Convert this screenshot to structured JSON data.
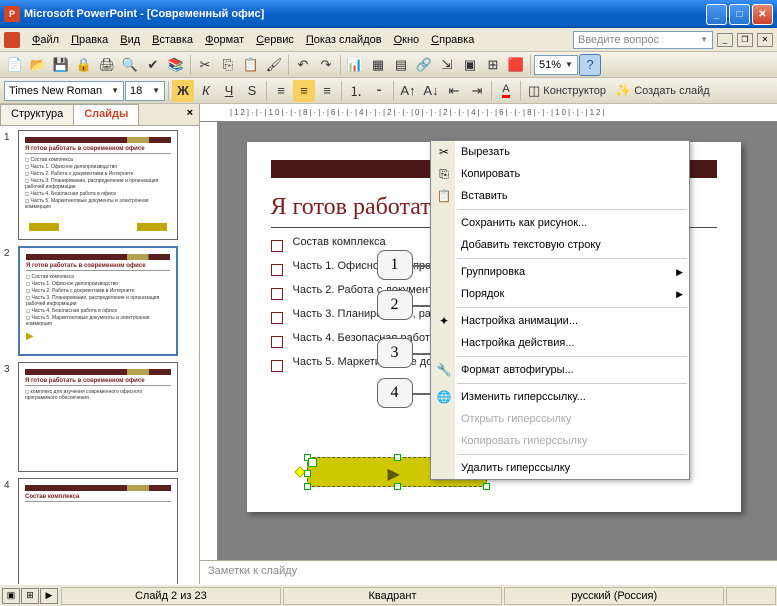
{
  "titlebar": {
    "app": "Microsoft PowerPoint",
    "doc": "[Современный офис]"
  },
  "menus": [
    "Файл",
    "Правка",
    "Вид",
    "Вставка",
    "Формат",
    "Сервис",
    "Показ слайдов",
    "Окно",
    "Справка"
  ],
  "help_placeholder": "Введите вопрос",
  "zoom": "51%",
  "font": {
    "name": "Times New Roman",
    "size": "18"
  },
  "design_btn": "Конструктор",
  "newslide_btn": "Создать слайд",
  "tabs": {
    "structure": "Структура",
    "slides": "Слайды"
  },
  "ruler": "|12|·|·|10|·|·|8|·|·|6|·|·|4|·|·|2|·|·|0|·|·|2|·|·|4|·|·|6|·|·|8|·|·|10|·|·|12|",
  "thumbs": [
    {
      "n": "1",
      "title": "Я готов работать в современном офисе",
      "lines": [
        "Состав комплекса",
        "Часть 1. Офисное делопроизводство",
        "Часть 2. Работа с документами в Интернете",
        "Часть 3. Планирование, распределение и организация рабочей информации",
        "Часть 4. Безопасная работа в офисе",
        "Часть 5. Маркетинговые документы и электронная коммерция"
      ]
    },
    {
      "n": "2",
      "title": "Я готов работать в современном офисе",
      "lines": [
        "Состав комплекса",
        "Часть 1. Офисное делопроизводство",
        "Часть 2. Работа с документами в Интернете",
        "Часть 3. Планирование, распределение и организация рабочей информации",
        "Часть 4. Безопасная работа в офисе",
        "Часть 5. Маркетинговые документы и электронная коммерция"
      ]
    },
    {
      "n": "3",
      "title": "Я готов работать в современном офисе",
      "lines": [
        "комплекс для изучения современного офисного программного обеспечения"
      ]
    },
    {
      "n": "4",
      "title": "Состав комплекса",
      "lines": []
    }
  ],
  "slide": {
    "title": "Я готов работать в современном офисе",
    "items": [
      "Состав комплекса",
      "Часть 1. Офисное делопроизводство",
      "Часть 2. Работа с документами в Интернете",
      "Часть 3. Планирование, распределение и организация рабочей информации",
      "Часть 4. Безопасная работа в офисе",
      "Часть 5. Маркетинговые документы и электронная коммерция"
    ]
  },
  "callouts": [
    "1",
    "2",
    "3",
    "4"
  ],
  "context_menu": [
    {
      "label": "Вырезать",
      "icon": "✂"
    },
    {
      "label": "Копировать",
      "icon": "⎘"
    },
    {
      "label": "Вставить",
      "icon": "📋"
    },
    {
      "sep": true
    },
    {
      "label": "Сохранить как рисунок..."
    },
    {
      "label": "Добавить текстовую строку"
    },
    {
      "sep": true
    },
    {
      "label": "Группировка",
      "sub": true
    },
    {
      "label": "Порядок",
      "sub": true
    },
    {
      "sep": true
    },
    {
      "label": "Настройка анимации...",
      "icon": "✦"
    },
    {
      "label": "Настройка действия..."
    },
    {
      "sep": true
    },
    {
      "label": "Формат автофигуры...",
      "icon": "🔧"
    },
    {
      "sep": true
    },
    {
      "label": "Изменить гиперссылку...",
      "icon": "🌐"
    },
    {
      "label": "Открыть гиперссылку",
      "disabled": true
    },
    {
      "label": "Копировать гиперссылку",
      "disabled": true
    },
    {
      "sep": true
    },
    {
      "label": "Удалить гиперссылку"
    }
  ],
  "notes": "Заметки к слайду",
  "status": {
    "slide": "Слайд 2 из 23",
    "layout": "Квадрант",
    "lang": "русский (Россия)"
  }
}
